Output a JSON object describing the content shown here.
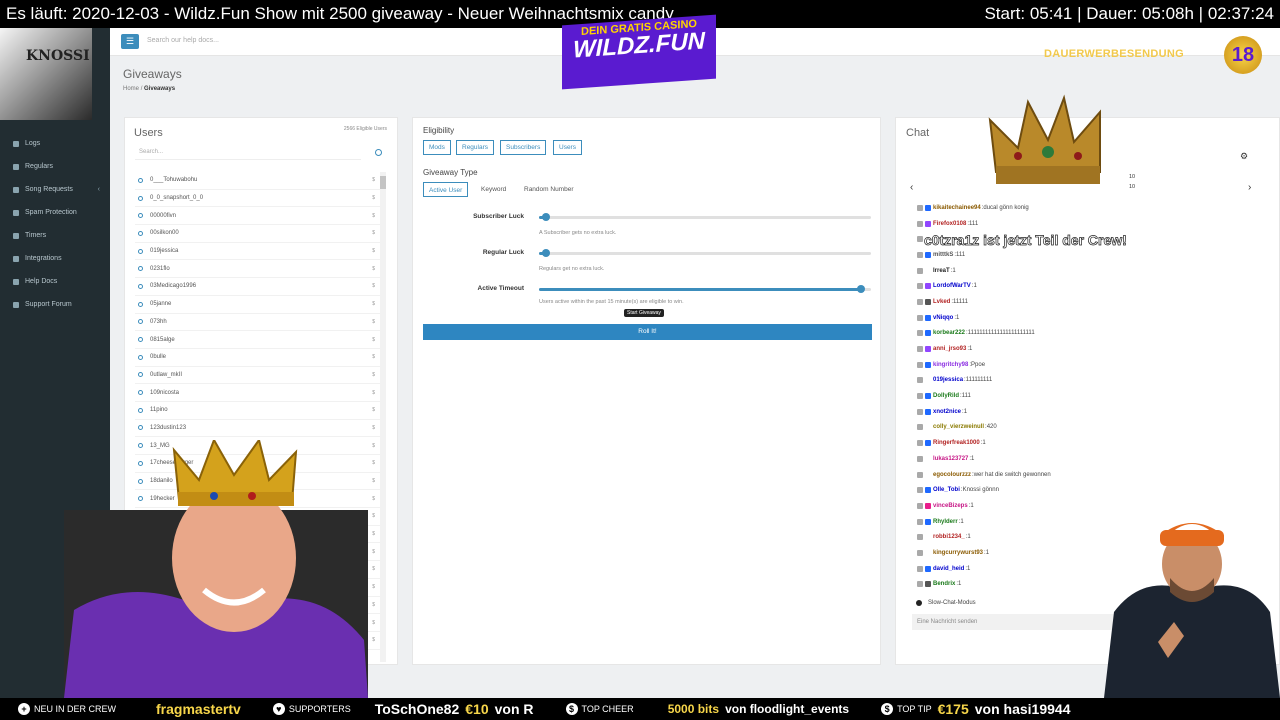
{
  "overlay": {
    "title": "Es läuft: 2020-12-03 - Wildz.Fun Show mit 2500 giveaway - Neuer Weihnachtsmix candy",
    "time": "Start: 05:41 | Dauer: 05:08h | 02:37:24",
    "logo_line1": "DEIN GRATIS CASINO",
    "logo_line2": "WILDZ.FUN",
    "dauer": "DAUERWERBESENDUNG",
    "age": "18",
    "crew_banner": "c0tzra1z ist jetzt Teil der Crew!",
    "thumb_text": "KNOSSI"
  },
  "sidebar": {
    "items": [
      {
        "label": "Logs",
        "icon": "list-icon"
      },
      {
        "label": "Regulars",
        "icon": "users-icon"
      },
      {
        "label": "Song Requests",
        "icon": "music-icon",
        "chevron": "‹"
      },
      {
        "label": "Spam Protection",
        "icon": "shield-icon"
      },
      {
        "label": "Timers",
        "icon": "clock-icon"
      },
      {
        "label": "Integrations",
        "icon": "plug-icon"
      },
      {
        "label": "Help Docs",
        "icon": "book-icon"
      },
      {
        "label": "Support Forum",
        "icon": "comments-icon"
      }
    ]
  },
  "header": {
    "menu_icon": "☰",
    "search_placeholder": "Search our help docs..."
  },
  "page": {
    "title": "Giveaways",
    "crumb_home": "Home",
    "crumb_sep": "/",
    "crumb_current": "Giveaways"
  },
  "users": {
    "title": "Users",
    "eligible": "2566 Eligible Users",
    "search_placeholder": "Search...",
    "currency": "$",
    "list": [
      "0___Tohuwabohu",
      "0_0_snapshort_0_0",
      "00000fivn",
      "00silkon00",
      "019jessica",
      "0231flo",
      "03Medicago1996",
      "05janne",
      "073hh",
      "0815alge",
      "0bulle",
      "0utlaw_mkII",
      "109nicosta",
      "11pino",
      "123dustin123",
      "13_MG",
      "17cheeseburger",
      "18danilo",
      "19hecker",
      "19eptik",
      "",
      "",
      "",
      "",
      "",
      "",
      ""
    ]
  },
  "eligibility": {
    "label": "Eligibility",
    "buttons": [
      "Mods",
      "Regulars",
      "Subscribers",
      "Users"
    ]
  },
  "giveaway_type": {
    "label": "Giveaway Type",
    "tabs": [
      "Active User",
      "Keyword",
      "Random Number"
    ]
  },
  "sliders": [
    {
      "label": "Subscriber Luck",
      "help": "A Subscriber gets no extra luck.",
      "value": 0.02
    },
    {
      "label": "Regular Luck",
      "help": "Regulars get no extra luck.",
      "value": 0.02
    },
    {
      "label": "Active Timeout",
      "help": "Users active within the past 15 minute(s) are eligible to win.",
      "value": 0.97
    }
  ],
  "roll": {
    "label": "Roll It!",
    "tooltip": "Start Giveaway"
  },
  "chat": {
    "title": "Chat",
    "prev": "‹",
    "next": "›",
    "counts": [
      "10",
      "10"
    ],
    "slow_mode": "Slow-Chat-Modus",
    "input_placeholder": "Eine Nachricht senden",
    "messages": [
      {
        "user": "kikaitechainee94",
        "text": "ducal gönn konig",
        "color": "#8a5a00",
        "badge": "#1f69ff"
      },
      {
        "user": "Firefox0108",
        "text": "111",
        "color": "#b22222",
        "badge": "#9146ff"
      },
      {
        "user": "",
        "text": "",
        "color": "#333",
        "badge": "#ffffff"
      },
      {
        "user": "mitttkS",
        "text": "111",
        "color": "#555",
        "badge": "#1f69ff"
      },
      {
        "user": "IrreaT",
        "text": "1",
        "color": "#222",
        "badge": "#ffffff"
      },
      {
        "user": "LordofWarTV",
        "text": "1",
        "color": "#0000cc",
        "badge": "#9146ff"
      },
      {
        "user": "Lvked",
        "text": "11111",
        "color": "#b22222",
        "badge": "#555555"
      },
      {
        "user": "vNiqqo",
        "text": "1",
        "color": "#0000cc",
        "badge": "#1f69ff"
      },
      {
        "user": "korbear222",
        "text": "11111111111111111111111",
        "color": "#1a7a1a",
        "badge": "#1f69ff"
      },
      {
        "user": "anni_jrso93",
        "text": "1",
        "color": "#b22222",
        "badge": "#9146ff"
      },
      {
        "user": "kingritchy98",
        "text": "Ppoe",
        "color": "#8a2be2",
        "badge": "#1f69ff"
      },
      {
        "user": "019jessica",
        "text": "111111111",
        "color": "#0000cc",
        "badge": "#ffffff"
      },
      {
        "user": "DollyRild",
        "text": "111",
        "color": "#1a7a1a",
        "badge": "#1f69ff"
      },
      {
        "user": "xnot2nice",
        "text": "1",
        "color": "#0000cc",
        "badge": "#1f69ff"
      },
      {
        "user": "colly_vierzweinull",
        "text": "420",
        "color": "#8a7a00",
        "badge": "#ffffff"
      },
      {
        "user": "Ringerfreak1000",
        "text": "1",
        "color": "#b22222",
        "badge": "#1f69ff"
      },
      {
        "user": "lukas123727",
        "text": "1",
        "color": "#c71585",
        "badge": "#ffffff"
      },
      {
        "user": "egocolourzzz",
        "text": "wer hat die switch gewonnen",
        "color": "#8a5a00",
        "badge": "#ffffff"
      },
      {
        "user": "Olle_Tobi",
        "text": "Knossi gönnn",
        "color": "#0000cc",
        "badge": "#1f69ff"
      },
      {
        "user": "vinceBizeps",
        "text": "1",
        "color": "#c71585",
        "badge": "#e91e8c"
      },
      {
        "user": "Rhylderr",
        "text": "1",
        "color": "#1a7a1a",
        "badge": "#1f69ff"
      },
      {
        "user": "robbi1234_",
        "text": "1",
        "color": "#b22222",
        "badge": "#ffffff"
      },
      {
        "user": "kingcurrywurst93",
        "text": "1",
        "color": "#8a5a00",
        "badge": "#ffffff"
      },
      {
        "user": "david_heid",
        "text": "1",
        "color": "#0000cc",
        "badge": "#1f69ff"
      },
      {
        "user": "Bendrix",
        "text": "1",
        "color": "#1a7a1a",
        "badge": "#555555"
      }
    ]
  },
  "ticker": {
    "new_crew_label": "NEU IN DER CREW",
    "new_crew": "fragmastertv",
    "supporters_label": "SUPPORTERS",
    "supporter": "ToSchOne82",
    "supporter_amount": "€10",
    "supporter_von": "von R",
    "cheer_label": "TOP CHEER",
    "cheer": "5000 bits",
    "cheer_von": "von floodlight_events",
    "tip_label": "TOP TIP",
    "tip_amount": "€175",
    "tip_von": "von hasi19944"
  }
}
